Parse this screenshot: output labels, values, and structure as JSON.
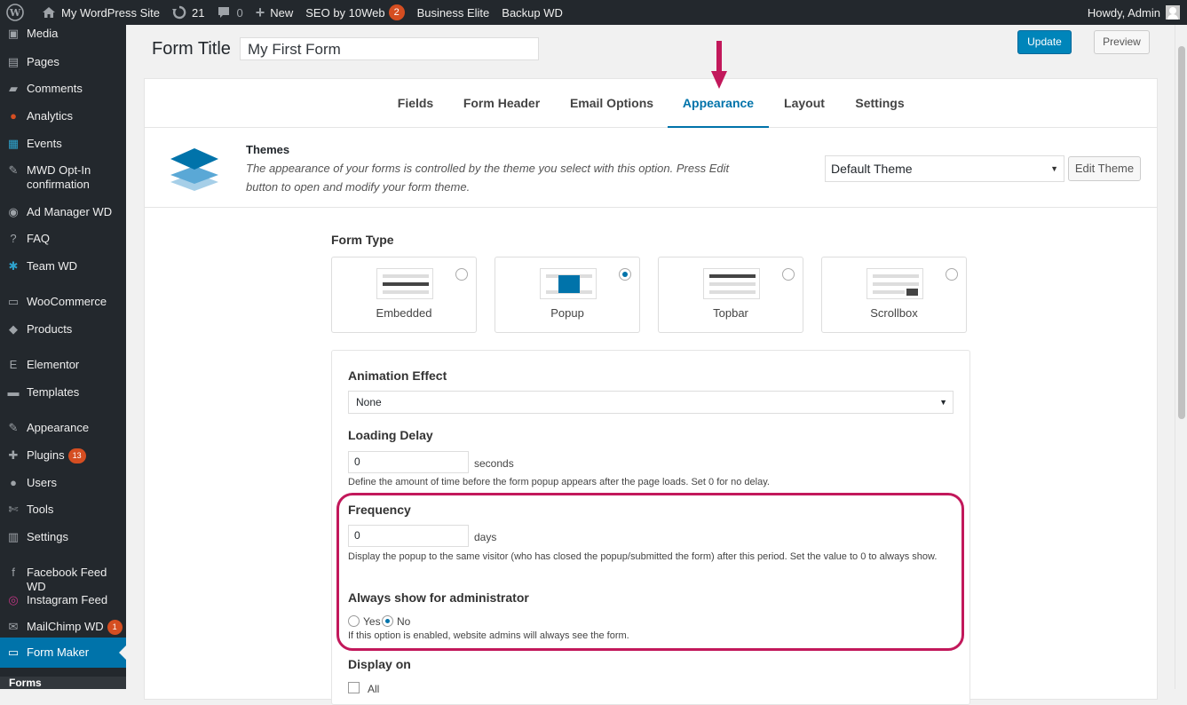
{
  "adminbar": {
    "site_name": "My WordPress Site",
    "updates_count": "21",
    "comments_count": "0",
    "new_label": "New",
    "seo_label": "SEO by 10Web",
    "seo_badge": "2",
    "business_label": "Business Elite",
    "backup_label": "Backup WD",
    "howdy": "Howdy, Admin"
  },
  "sidebar": {
    "items": [
      {
        "label": "Media",
        "icon": "media-icon"
      },
      {
        "label": "Pages",
        "icon": "pages-icon"
      },
      {
        "label": "Comments",
        "icon": "comments-icon"
      },
      {
        "label": "Analytics",
        "icon": "analytics-icon"
      },
      {
        "label": "Events",
        "icon": "events-icon"
      },
      {
        "label": "MWD Opt-In confirmation",
        "icon": "pin-icon"
      },
      {
        "label": "Ad Manager WD",
        "icon": "ad-manager-icon"
      },
      {
        "label": "FAQ",
        "icon": "faq-icon"
      },
      {
        "label": "Team WD",
        "icon": "team-icon"
      },
      {
        "label": "WooCommerce",
        "icon": "woocommerce-icon"
      },
      {
        "label": "Products",
        "icon": "products-icon"
      },
      {
        "label": "Elementor",
        "icon": "elementor-icon"
      },
      {
        "label": "Templates",
        "icon": "templates-icon"
      },
      {
        "label": "Appearance",
        "icon": "appearance-icon"
      },
      {
        "label": "Plugins",
        "icon": "plugins-icon",
        "badge": "13"
      },
      {
        "label": "Users",
        "icon": "users-icon"
      },
      {
        "label": "Tools",
        "icon": "tools-icon"
      },
      {
        "label": "Settings",
        "icon": "settings-icon"
      },
      {
        "label": "Facebook Feed WD",
        "icon": "facebook-icon"
      },
      {
        "label": "Instagram Feed",
        "icon": "instagram-icon"
      },
      {
        "label": "MailChimp WD",
        "icon": "mailchimp-icon",
        "badge": "1"
      },
      {
        "label": "Form Maker",
        "icon": "form-maker-icon"
      }
    ],
    "submenu_forms": "Forms"
  },
  "header": {
    "form_title_label": "Form Title",
    "form_title_value": "My First Form",
    "update_label": "Update",
    "preview_label": "Preview"
  },
  "tabs": [
    "Fields",
    "Form Header",
    "Email Options",
    "Appearance",
    "Layout",
    "Settings"
  ],
  "themes": {
    "title": "Themes",
    "description": "The appearance of your forms is controlled by the theme you select with this option. Press Edit button to open and modify your form theme.",
    "selected_theme": "Default Theme",
    "edit_label": "Edit Theme"
  },
  "form_type": {
    "title": "Form Type",
    "options": [
      {
        "label": "Embedded",
        "selected": false
      },
      {
        "label": "Popup",
        "selected": true
      },
      {
        "label": "Topbar",
        "selected": false
      },
      {
        "label": "Scrollbox",
        "selected": false
      }
    ]
  },
  "options": {
    "animation_label": "Animation Effect",
    "animation_value": "None",
    "delay_label": "Loading Delay",
    "delay_value": "0",
    "delay_unit": "seconds",
    "delay_help": "Define the amount of time before the form popup appears after the page loads. Set 0 for no delay.",
    "frequency_label": "Frequency",
    "frequency_value": "0",
    "frequency_unit": "days",
    "frequency_help": "Display the popup to the same visitor (who has closed the popup/submitted the form) after this period. Set the value to 0 to always show.",
    "admin_label": "Always show for administrator",
    "yes_label": "Yes",
    "no_label": "No",
    "admin_help": "If this option is enabled, website admins will always see the form.",
    "display_on_label": "Display on",
    "display_all_label": "All"
  },
  "colors": {
    "accent": "#0073aa",
    "highlight": "#c2185b",
    "adminbar": "#23282d"
  }
}
